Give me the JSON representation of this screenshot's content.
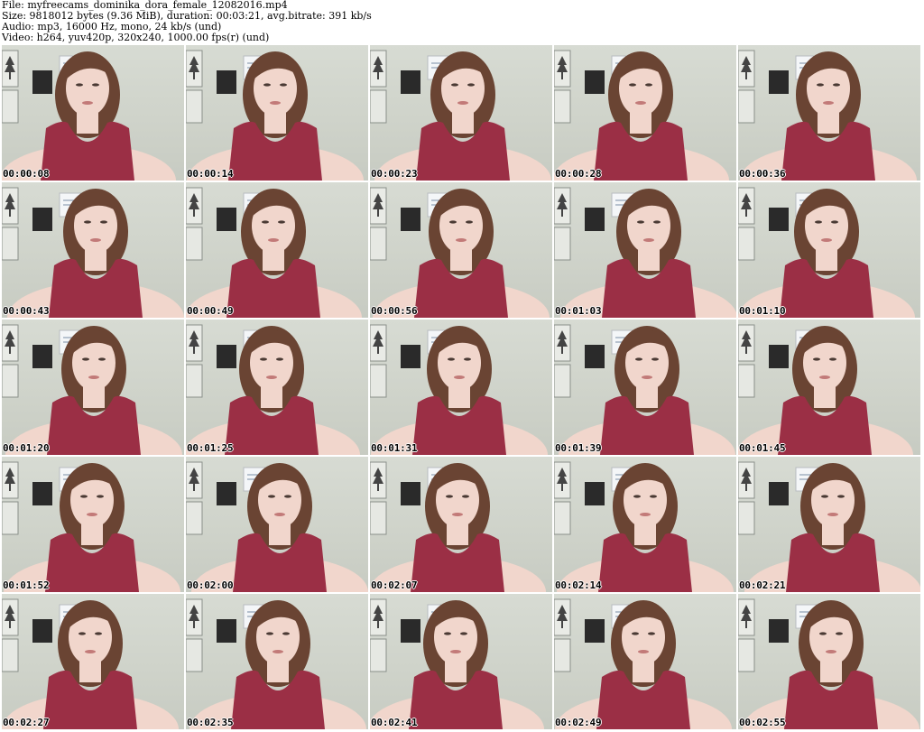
{
  "header": {
    "file": "File: myfreecams_dominika_dora_female_12082016.mp4",
    "size": "Size: 9818012 bytes (9.36 MiB), duration: 00:03:21, avg.bitrate: 391 kb/s",
    "audio": "Audio: mp3, 16000 Hz, mono, 24 kb/s (und)",
    "video": "Video: h264, yuv420p, 320x240, 1000.00 fps(r) (und)"
  },
  "colors": {
    "wall": "#d3d7cf",
    "top": "#9b2f45",
    "skin": "#f1d6cc",
    "hair": "#6a4433",
    "frame": "#2a2a2a"
  },
  "thumbnails": [
    {
      "time": "00:00:08"
    },
    {
      "time": "00:00:14"
    },
    {
      "time": "00:00:23"
    },
    {
      "time": "00:00:28"
    },
    {
      "time": "00:00:36"
    },
    {
      "time": "00:00:43"
    },
    {
      "time": "00:00:49"
    },
    {
      "time": "00:00:56"
    },
    {
      "time": "00:01:03"
    },
    {
      "time": "00:01:10"
    },
    {
      "time": "00:01:20"
    },
    {
      "time": "00:01:25"
    },
    {
      "time": "00:01:31"
    },
    {
      "time": "00:01:39"
    },
    {
      "time": "00:01:45"
    },
    {
      "time": "00:01:52"
    },
    {
      "time": "00:02:00"
    },
    {
      "time": "00:02:07"
    },
    {
      "time": "00:02:14"
    },
    {
      "time": "00:02:21"
    },
    {
      "time": "00:02:27"
    },
    {
      "time": "00:02:35"
    },
    {
      "time": "00:02:41"
    },
    {
      "time": "00:02:49"
    },
    {
      "time": "00:02:55"
    }
  ]
}
